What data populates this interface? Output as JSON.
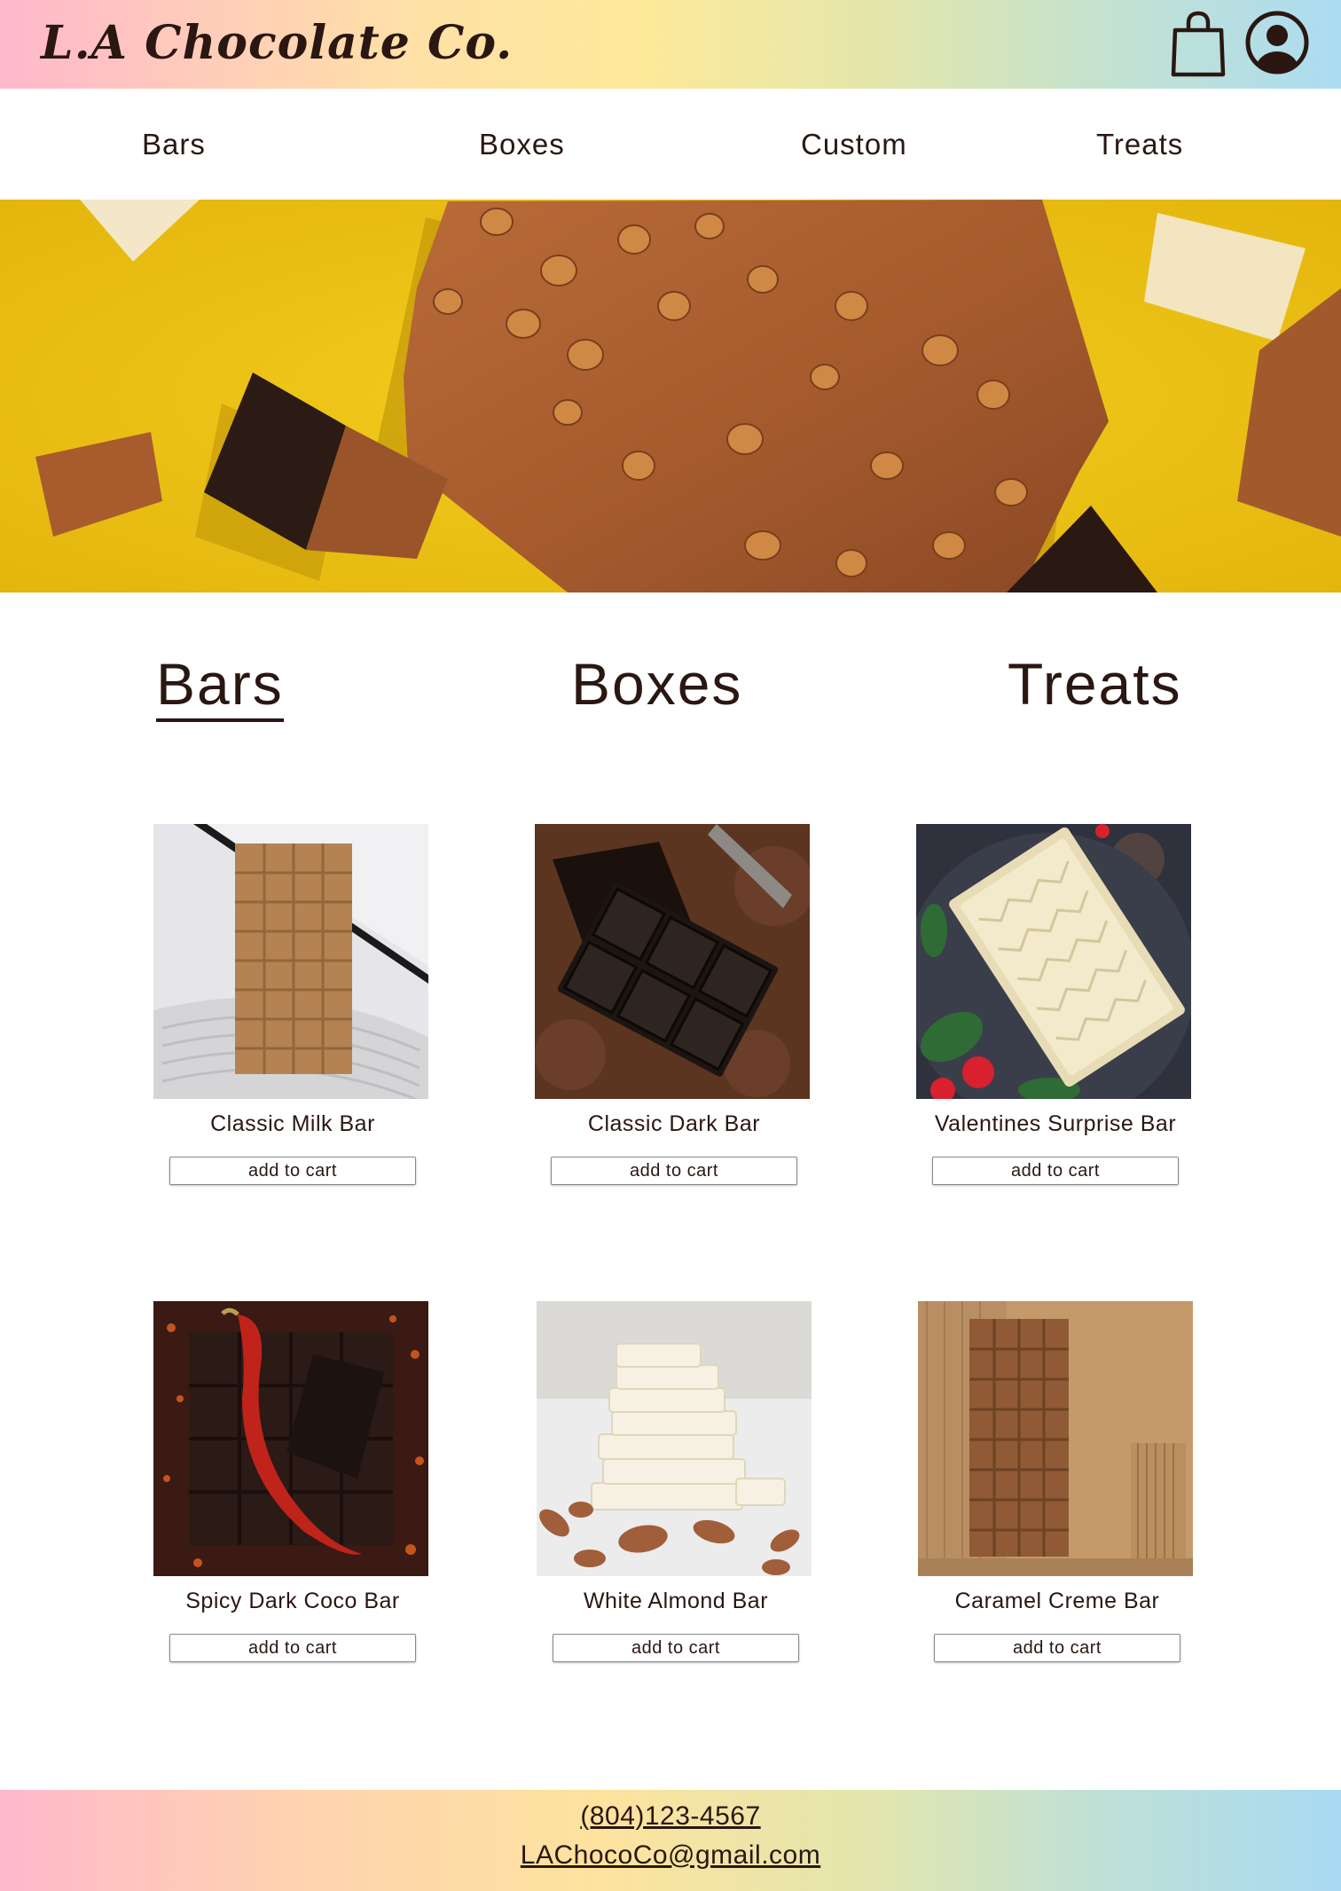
{
  "header": {
    "logo_text": "L.A Chocolate Co.",
    "cart_icon": "shopping-bag-icon",
    "account_icon": "user-circle-icon"
  },
  "nav": {
    "items": [
      "Bars",
      "Boxes",
      "Custom",
      "Treats"
    ]
  },
  "hero": {
    "image": "chocolate-bars-on-yellow-background",
    "background_color": "#F2C919"
  },
  "categories": {
    "tabs": [
      "Bars",
      "Boxes",
      "Treats"
    ],
    "active": "Bars"
  },
  "products": [
    {
      "name": "Classic Milk Bar",
      "button": "add to cart",
      "image": "milk-chocolate-bar"
    },
    {
      "name": "Classic Dark Bar",
      "button": "add to cart",
      "image": "dark-chocolate-bar"
    },
    {
      "name": "Valentines Surprise Bar",
      "button": "add to cart",
      "image": "white-chocolate-bar-roses"
    },
    {
      "name": "Spicy Dark Coco Bar",
      "button": "add to cart",
      "image": "dark-chocolate-chili"
    },
    {
      "name": "White Almond Bar",
      "button": "add to cart",
      "image": "white-chocolate-almonds"
    },
    {
      "name": "Caramel Creme Bar",
      "button": "add to cart",
      "image": "caramel-chocolate-bar"
    }
  ],
  "footer": {
    "phone": "(804)123-4567",
    "email": "LAChocoCo@gmail.com"
  },
  "colors": {
    "text": "#2A1712",
    "gradient_pink": "#FFB8CC",
    "gradient_yellow": "#FDE99A",
    "gradient_blue": "#ACDCF2"
  }
}
